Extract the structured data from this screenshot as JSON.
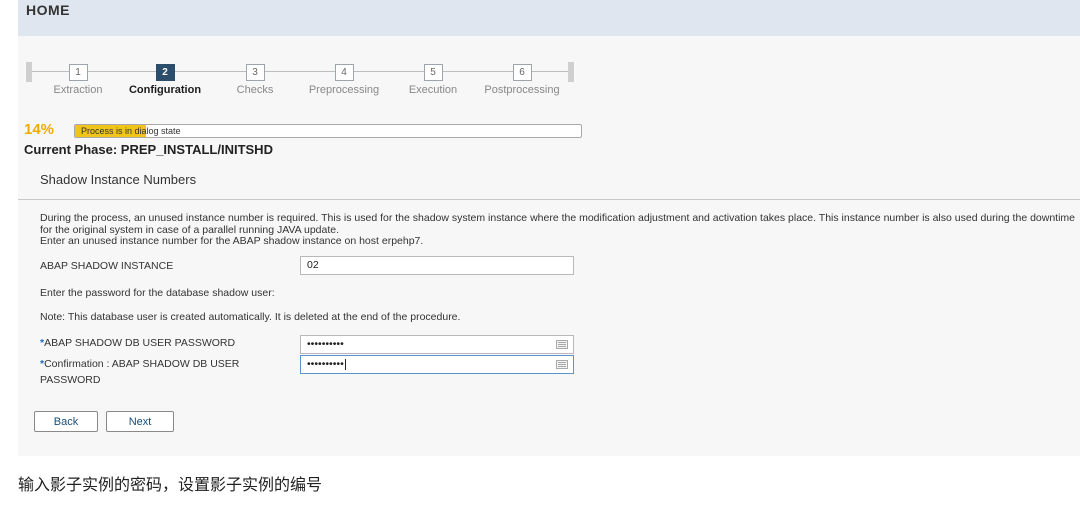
{
  "header": {
    "title": "HOME"
  },
  "roadmap": {
    "steps": [
      {
        "number": "1",
        "label": "Extraction"
      },
      {
        "number": "2",
        "label": "Configuration"
      },
      {
        "number": "3",
        "label": "Checks"
      },
      {
        "number": "4",
        "label": "Preprocessing"
      },
      {
        "number": "5",
        "label": "Execution"
      },
      {
        "number": "6",
        "label": "Postprocessing"
      }
    ],
    "active_step": 2
  },
  "progress": {
    "percent_label": "14%",
    "fraction": 0.14,
    "status_text": "Process is in dialog state",
    "phase": "Current Phase: PREP_INSTALL/INITSHD",
    "accent_color": "#f0ab00"
  },
  "section": {
    "title": "Shadow Instance Numbers"
  },
  "description": {
    "paragraph": "During the process, an unused instance number is required. This is used for the shadow system instance where the modification adjustment and activation takes place. This instance number is also used during the downtime for the original system in case of a parallel running JAVA update.",
    "instruction": "Enter an unused instance number for the ABAP shadow instance on host erpehp7."
  },
  "form": {
    "instance_label": "ABAP SHADOW INSTANCE",
    "instance_value": "02",
    "password_prompt": "Enter the password for the database shadow user:",
    "note": "Note: This database user is created automatically. It is deleted at the end of the procedure.",
    "required_marker": "*",
    "password_label": "ABAP SHADOW DB USER PASSWORD",
    "password_value": "••••••••••",
    "confirm_label_line1": "Confirmation : ABAP SHADOW DB USER",
    "confirm_label_line2": "PASSWORD",
    "confirm_value": "••••••••••",
    "keyboard_icon": "virtual-keyboard-icon"
  },
  "buttons": {
    "back": "Back",
    "next": "Next"
  },
  "caption": "输入影子实例的密码，设置影子实例的编号"
}
